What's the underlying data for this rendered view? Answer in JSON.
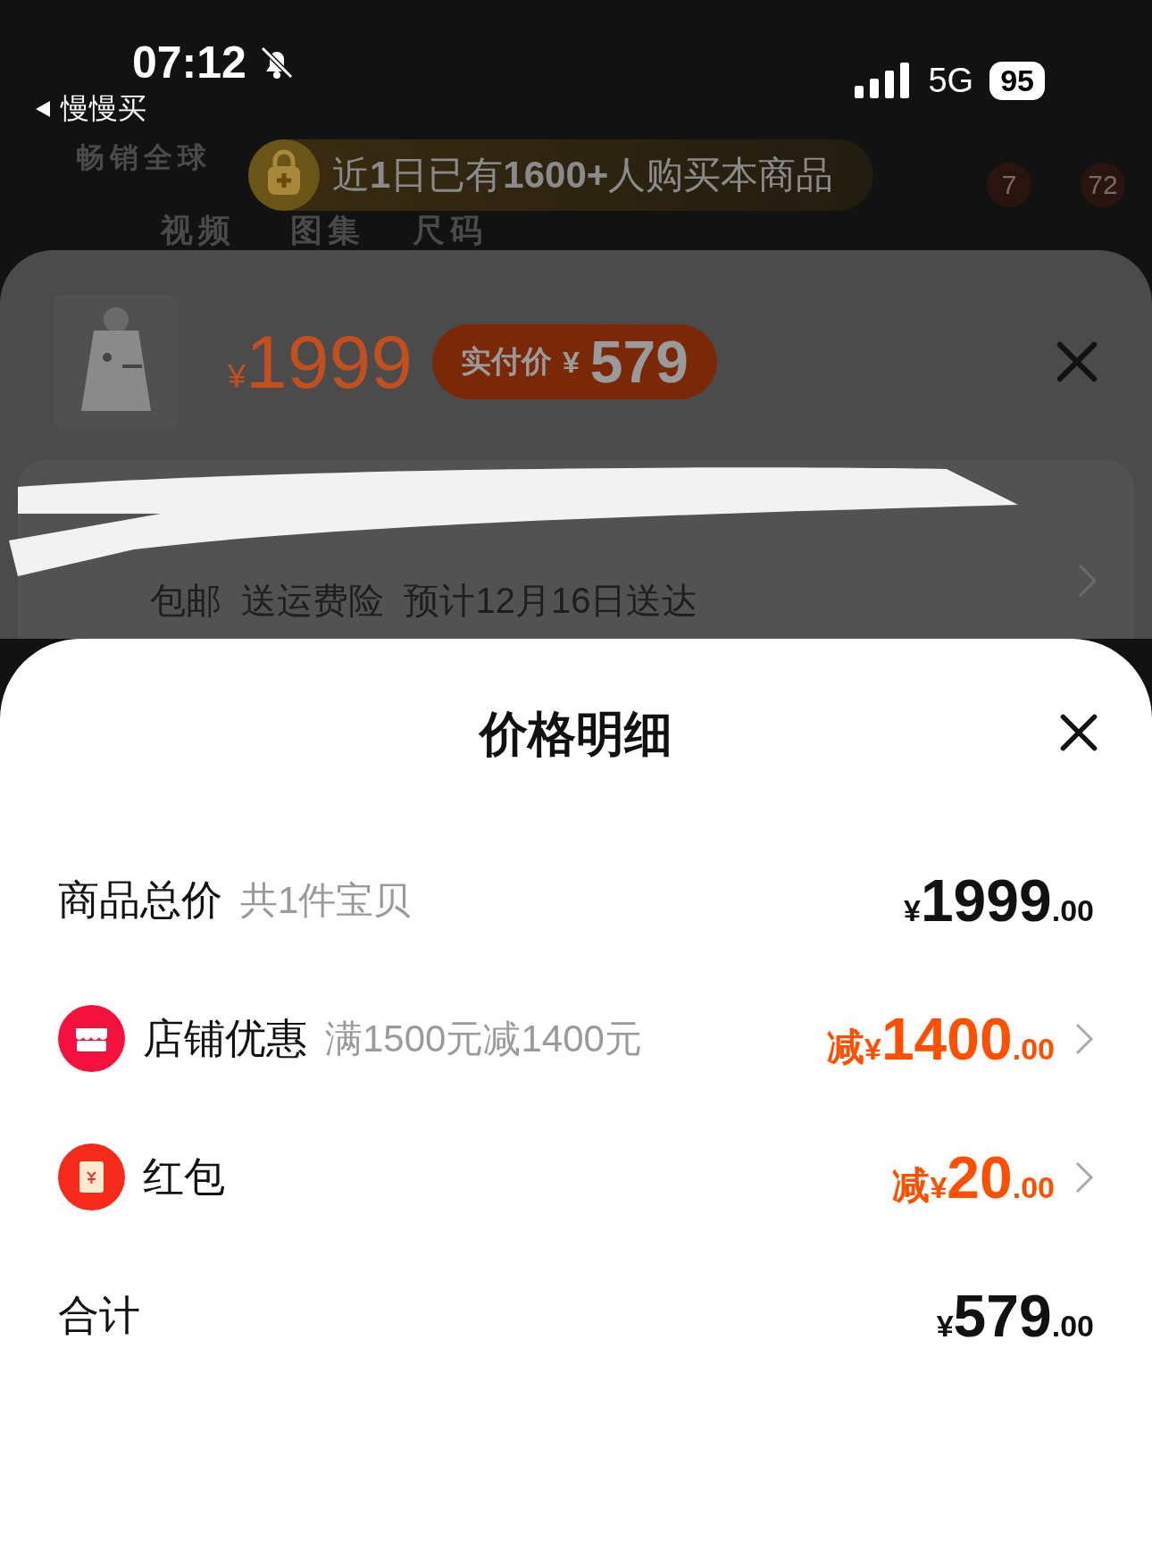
{
  "status_bar": {
    "time": "07:12",
    "back_label": "慢慢买",
    "network": "5G",
    "battery": "95"
  },
  "background_page": {
    "slogan": "畅销全球",
    "tabs": [
      {
        "label": "视频"
      },
      {
        "label": "图集"
      },
      {
        "label": "尺码"
      }
    ],
    "badges": [
      "7",
      "72"
    ]
  },
  "purchase_banner": {
    "text": "近**1**日已有**1600+**人购买本商品"
  },
  "product_sheet": {
    "currency": "¥",
    "price": "1999",
    "pay_label": "实付价",
    "pay_currency": "¥",
    "pay_price": "579",
    "shipping": "包邮  送运费险  预计12月16日送达"
  },
  "price_detail": {
    "title": "价格明细",
    "rows": [
      {
        "kind": "plain",
        "label": "商品总价",
        "note": "共1件宝贝",
        "currency": "¥",
        "amount": "1999",
        "decimals": ".00"
      },
      {
        "kind": "store",
        "label": "店铺优惠",
        "note": "满1500元减1400元",
        "prefix": "减",
        "currency": "¥",
        "amount": "1400",
        "decimals": ".00"
      },
      {
        "kind": "packet",
        "label": "红包",
        "prefix": "减",
        "currency": "¥",
        "amount": "20",
        "decimals": ".00"
      },
      {
        "kind": "plain",
        "label": "合计",
        "currency": "¥",
        "amount": "579",
        "decimals": ".00"
      }
    ]
  }
}
